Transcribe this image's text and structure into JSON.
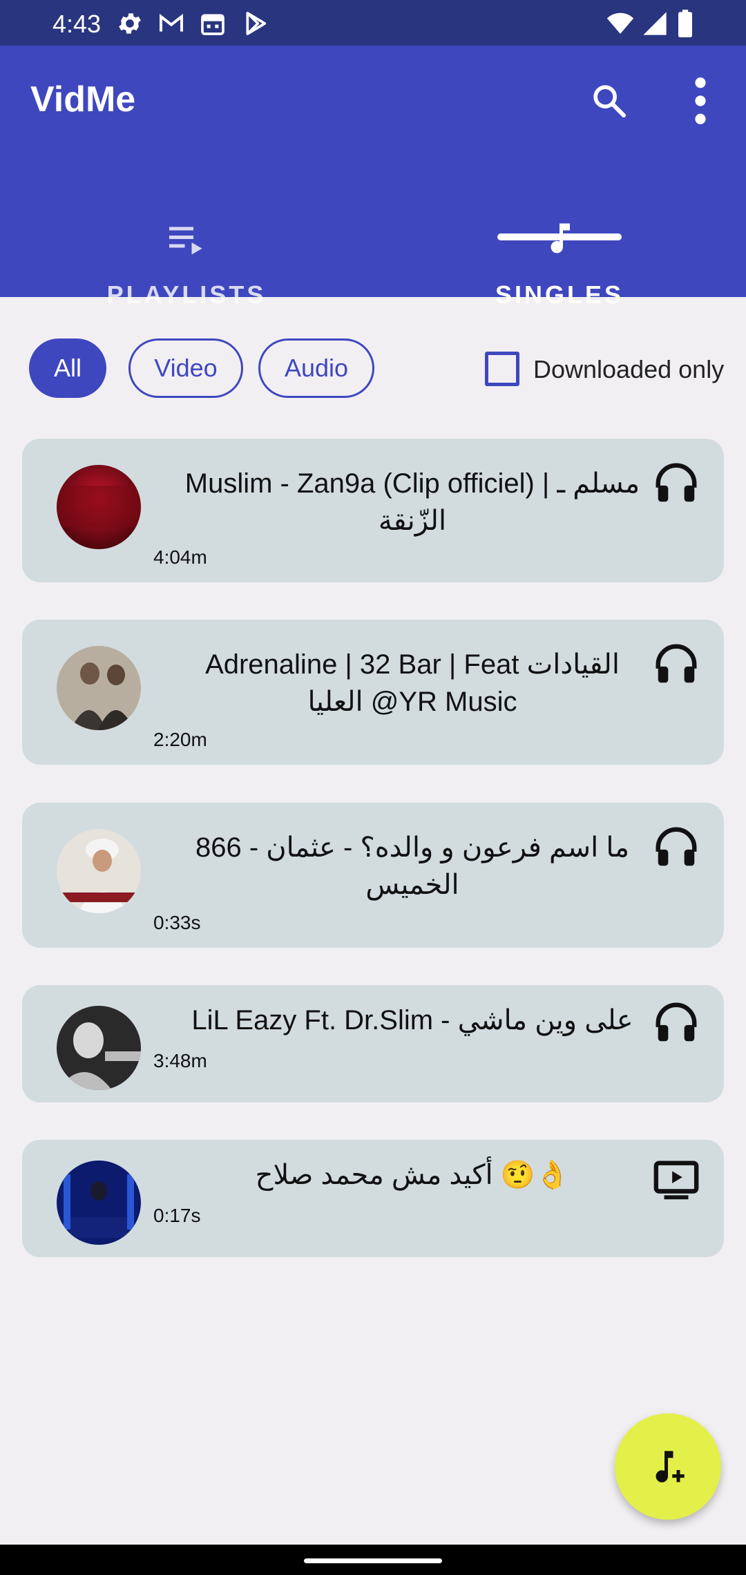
{
  "status_bar": {
    "time": "4:43",
    "left_icons": [
      "gear-icon",
      "gmail-icon",
      "calendar-icon",
      "play-store-icon"
    ],
    "right_icons": [
      "wifi-icon",
      "signal-icon",
      "battery-icon"
    ]
  },
  "app_bar": {
    "title": "VidMe",
    "actions": [
      "search-icon",
      "more-vert-icon"
    ],
    "background": "#3f47bf"
  },
  "tabs": [
    {
      "label": "PLAYLISTS",
      "icon": "playlist-play-icon",
      "selected": false
    },
    {
      "label": "SINGLES",
      "icon": "music-note-icon",
      "selected": true
    }
  ],
  "filters": {
    "chips": [
      {
        "label": "All",
        "selected": true
      },
      {
        "label": "Video",
        "selected": false
      },
      {
        "label": "Audio",
        "selected": false
      }
    ],
    "downloaded_only_label": "Downloaded only",
    "downloaded_only_checked": false
  },
  "items": [
    {
      "title": "Muslim - Zan9a (Clip officiel)  |  مسلم ـ الزّنقة",
      "duration": "4:04m",
      "type_icon": "headphones-icon"
    },
    {
      "title": "Adrenaline | 32 Bar | Feat القيادات العليا @YR Music",
      "duration": "2:20m",
      "type_icon": "headphones-icon"
    },
    {
      "title": "866 - ما اسم فرعون و والده؟ - عثمان الخميس",
      "duration": "0:33s",
      "type_icon": "headphones-icon"
    },
    {
      "title": "LiL Eazy Ft. Dr.Slim - على وين ماشي",
      "duration": "3:48m",
      "type_icon": "headphones-icon"
    },
    {
      "title": "أكيد مش محمد صلاح 🤨👌",
      "duration": "0:17s",
      "type_icon": "video-icon"
    }
  ],
  "fab": {
    "icon": "add-music-icon",
    "color": "#e3f04a"
  },
  "colors": {
    "primary": "#3f47bf",
    "status_bar": "#29357f",
    "card": "#d2dcdf",
    "background": "#f2eff3"
  }
}
